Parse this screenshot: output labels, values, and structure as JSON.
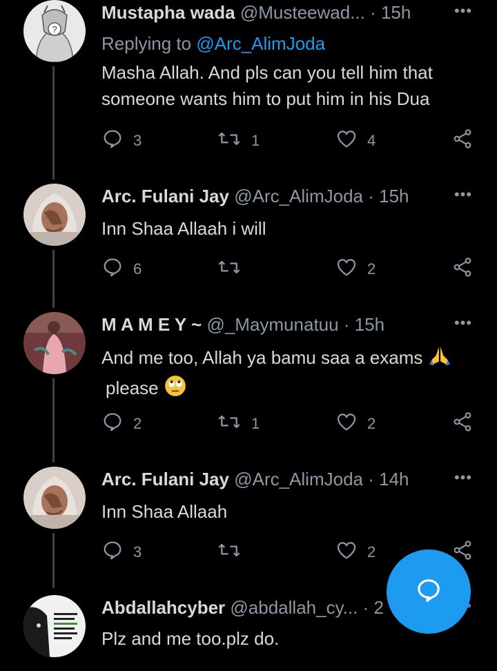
{
  "tweets": [
    {
      "name": "Mustapha wada",
      "handle": "@Musteewad...",
      "sep": " · ",
      "time": "15h",
      "reply_prefix": "Replying to ",
      "reply_handle": "@Arc_AlimJoda",
      "text": "Masha Allah. And pls can you tell him that someone wants him to put him in his Dua",
      "replies": "3",
      "retweets": "1",
      "likes": "4"
    },
    {
      "name": "Arc. Fulani Jay",
      "handle": "@Arc_AlimJoda",
      "sep": " · ",
      "time": "15h",
      "text": "Inn Shaa Allaah i will",
      "replies": "6",
      "retweets": "",
      "likes": "2"
    },
    {
      "name": "M A M E Y ~",
      "handle": "@_Maymunatuu",
      "sep": " · ",
      "time": "15h",
      "text_line1": "And me too, Allah ya bamu saa a exams",
      "text_line2": "please",
      "replies": "2",
      "retweets": "1",
      "likes": "2"
    },
    {
      "name": "Arc. Fulani Jay",
      "handle": "@Arc_AlimJoda",
      "sep": " · ",
      "time": "14h",
      "text": "Inn Shaa Allaah",
      "replies": "3",
      "retweets": "",
      "likes": "2"
    },
    {
      "name": "Abdallahcyber",
      "handle": "@abdallah_cy...",
      "sep": " · ",
      "time": "2",
      "text": "Plz and me too.plz do."
    }
  ],
  "more_label": "•••",
  "colors": {
    "background": "#000000",
    "text": "#d9d9d9",
    "muted": "#8b98a5",
    "accent": "#1d9bf0"
  },
  "icons": {
    "reply": "reply-icon",
    "retweet": "retweet-icon",
    "like": "heart-icon",
    "share": "share-icon",
    "compose": "compose-reply-icon"
  }
}
